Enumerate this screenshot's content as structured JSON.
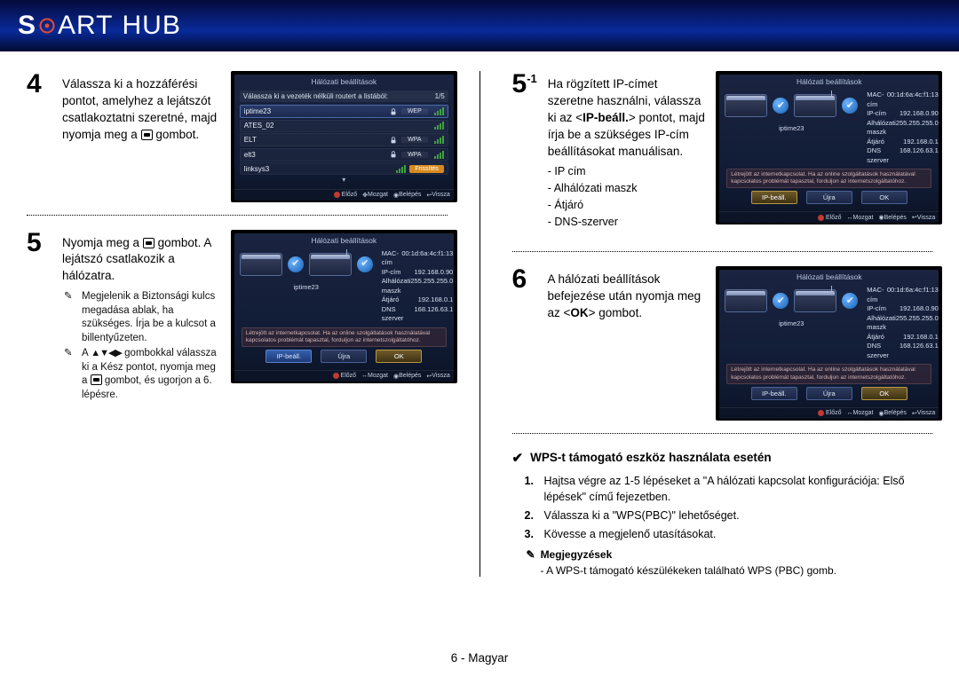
{
  "header": {
    "brand_s": "S",
    "brand_rest": "ART",
    "hub": "HUB"
  },
  "steps": {
    "s4": {
      "num": "4",
      "text": "Válassza ki a hozzáférési pontot, amelyhez a lejátszót csatlakoztatni szeretné, majd nyomja meg a",
      "text_tail": "gombot."
    },
    "s5": {
      "num": "5",
      "lead": "Nyomja meg a",
      "text": "gombot. A lejátszó csatlakozik a hálózatra.",
      "note1": "Megjelenik a Biztonsági kulcs megadása ablak, ha szükséges. Írja be a kulcsot a billentyűzeten.",
      "note2a": "A",
      "note2b": "gombokkal válassza ki a Kész pontot, nyomja meg a",
      "note2c": "gombot, és ugorjon a 6. lépésre."
    },
    "s5_1": {
      "num": "5",
      "sup": "-1",
      "text1": "Ha rögzített IP-címet szeretne használni, válassza ki az <",
      "bold": "IP-beáll.",
      "text2": "> pontot, majd írja be a szükséges IP-cím beállításokat manuálisan.",
      "items": [
        "IP cím",
        "Alhálózati maszk",
        "Átjáró",
        "DNS-szerver"
      ]
    },
    "s6": {
      "num": "6",
      "text": "A hálózati beállítások befejezése után nyomja meg az <",
      "bold": "OK",
      "text2": "> gombot."
    }
  },
  "wps": {
    "title": "WPS-t támogató eszköz használata esetén",
    "items": [
      "Hajtsa végre az 1-5 lépéseket a \"A hálózati kapcsolat konfigurációja: Első lépések\" című fejezetben.",
      "Válassza ki a \"WPS(PBC)\" lehetőséget.",
      "Kövesse a megjelenő utasításokat."
    ],
    "remark_label": "Megjegyzések",
    "remark_text": "A WPS-t támogató készülékeken található WPS (PBC) gomb."
  },
  "tv": {
    "title": "Hálózati beállítások",
    "ap_instr": "Válassza ki a vezeték nélküli routert a listából:",
    "ap_count": "1/5",
    "aps": [
      {
        "name": "iptime23",
        "sec": "WEP"
      },
      {
        "name": "ATES_02",
        "sec": ""
      },
      {
        "name": "ELT",
        "sec": "WPA"
      },
      {
        "name": "elt3",
        "sec": "WPA"
      },
      {
        "name": "linksys3",
        "sec": ""
      }
    ],
    "refresh": "Frissítés",
    "bar": {
      "prev": "Előző",
      "move": "Mozgat",
      "enter": "Belépés",
      "back": "Vissza"
    },
    "conn": {
      "mac_k": "MAC-cím",
      "mac_v": "00:1d:6a:4c:f1:13",
      "ip_k": "IP-cím",
      "ip_v": "192.168.0.90",
      "mask_k": "Alhálózati maszk",
      "mask_v": "255.255.255.0",
      "gw_k": "Átjáró",
      "gw_v": "192.168.0.1",
      "dns_k": "DNS szerver",
      "dns_v": "168.126.63.1",
      "net_name": "iptime23",
      "hint": "Létrejött az internetkapcsolat. Ha az online szolgáltatások használatával kapcsolatos problémát tapasztal, forduljon az internetszolgáltatóhoz."
    },
    "btns": {
      "ip": "IP-beáll.",
      "retry": "Újra",
      "ok": "OK"
    }
  },
  "footer": "6 - Magyar"
}
